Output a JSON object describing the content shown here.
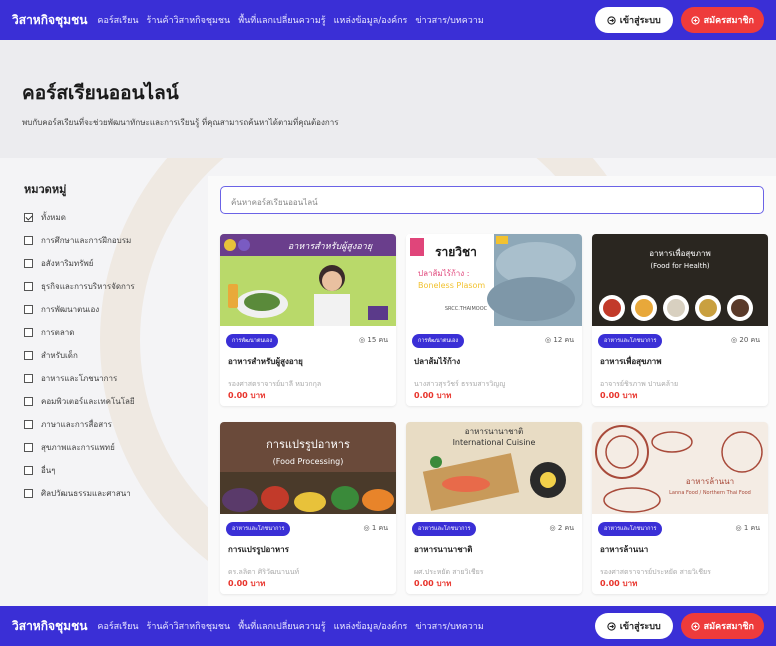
{
  "nav": {
    "brand": "วิสาหกิจชุมชน",
    "links": [
      "คอร์สเรียน",
      "ร้านค้าวิสาหกิจชุมชน",
      "พื้นที่แลกเปลี่ยนความรู้",
      "แหล่งข้อมูล/องค์กร",
      "ข่าวสาร/บทความ"
    ],
    "login": "เข้าสู่ระบบ",
    "register": "สมัครสมาชิก"
  },
  "hero": {
    "title": "คอร์สเรียนออนไลน์",
    "subtitle": "พบกับคอร์สเรียนที่จะช่วยพัฒนาทักษะและการเรียนรู้ ที่คุณสามารถค้นหาได้ตามที่คุณต้องการ"
  },
  "sidebar": {
    "heading": "หมวดหมู่",
    "categories": [
      {
        "label": "ทั้งหมด",
        "checked": true
      },
      {
        "label": "การศึกษาและการฝึกอบรม",
        "checked": false
      },
      {
        "label": "อสังหาริมทรัพย์",
        "checked": false
      },
      {
        "label": "ธุรกิจและการบริหารจัดการ",
        "checked": false
      },
      {
        "label": "การพัฒนาตนเอง",
        "checked": false
      },
      {
        "label": "การตลาด",
        "checked": false
      },
      {
        "label": "สำหรับเด็ก",
        "checked": false
      },
      {
        "label": "อาหารและโภชนาการ",
        "checked": false
      },
      {
        "label": "คอมพิวเตอร์และเทคโนโลยี",
        "checked": false
      },
      {
        "label": "ภาษาและการสื่อสาร",
        "checked": false
      },
      {
        "label": "สุขภาพและการแพทย์",
        "checked": false
      },
      {
        "label": "อื่นๆ",
        "checked": false
      },
      {
        "label": "ศิลปวัฒนธรรมและศาสนา",
        "checked": false
      }
    ]
  },
  "search": {
    "placeholder": "ค้นหาคอร์สเรียนออนไลน์"
  },
  "courses": [
    {
      "tag": "การพัฒนาตนเอง",
      "count": "15 คน",
      "title": "อาหารสำหรับผู้สูงอายุ",
      "instructor": "รองศาสตราจารย์มาลี หมวกกุล",
      "price": "0.00 บาท",
      "thumb_text": "อาหารสำหรับผู้สูงอายุ"
    },
    {
      "tag": "การพัฒนาตนเอง",
      "count": "12 คน",
      "title": "ปลาส้มไร้ก้าง",
      "instructor": "นางสาวสุรวัชร์ ธรรมสารวิญญู",
      "price": "0.00 บาท",
      "thumb_text": "รายวิชา",
      "thumb_sub1": "ปลาส้มไร้ก้าง :",
      "thumb_sub2": "Boneless Plasom",
      "thumb_sub3": "SRCC.THAIMOOC"
    },
    {
      "tag": "อาหารและโภชนาการ",
      "count": "20 คน",
      "title": "อาหารเพื่อสุขภาพ",
      "instructor": "อาจารย์ชิรภาพ ปานคล้าย",
      "price": "0.00 บาท",
      "thumb_text": "อาหารเพื่อสุขภาพ",
      "thumb_sub1": "(Food for Health)"
    },
    {
      "tag": "อาหารและโภชนาการ",
      "count": "1 คน",
      "title": "การแปรรูปอาหาร",
      "instructor": "ดร.ลลิตา ศิริวัฒนานนท์",
      "price": "0.00 บาท",
      "thumb_text": "การแปรรูปอาหาร",
      "thumb_sub1": "(Food Processing)"
    },
    {
      "tag": "อาหารและโภชนาการ",
      "count": "2 คน",
      "title": "อาหารนานาชาติ",
      "instructor": "ผศ.ประหยัด สายวิเชียร",
      "price": "0.00 บาท",
      "thumb_text": "อาหารนานาชาติ",
      "thumb_sub1": "International Cuisine"
    },
    {
      "tag": "อาหารและโภชนาการ",
      "count": "1 คน",
      "title": "อาหารล้านนา",
      "instructor": "รองศาสตราจารย์ประหยัด สายวิเชียร",
      "price": "0.00 บาท",
      "thumb_text": "อาหารล้านนา",
      "thumb_sub1": "Lanna Food / Northern Thai Food"
    }
  ],
  "colors": {
    "primary": "#3a2fd6",
    "accent": "#ee3b3b",
    "price": "#e8342c"
  }
}
